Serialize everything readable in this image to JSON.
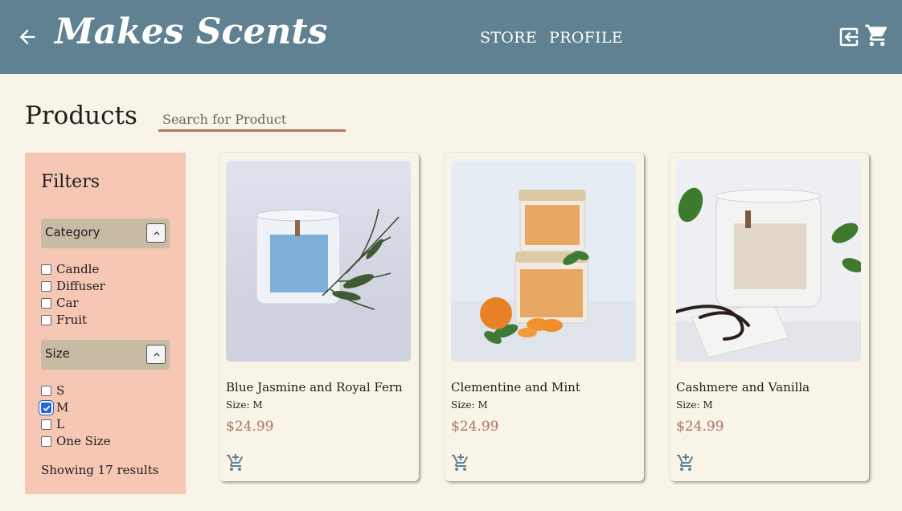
{
  "header": {
    "brand": "Makes Scents",
    "nav": [
      {
        "label": "STORE"
      },
      {
        "label": "PROFILE"
      }
    ],
    "icons": [
      "arrow-left-icon",
      "logout-icon",
      "shopping-cart-icon"
    ],
    "background_color": "#5f8191"
  },
  "main": {
    "title": "Products",
    "search": {
      "placeholder": "Search for Product",
      "value": ""
    }
  },
  "filters": {
    "title": "Filters",
    "category": {
      "label": "Category",
      "expanded": true,
      "options": [
        {
          "label": "Candle",
          "checked": false
        },
        {
          "label": "Diffuser",
          "checked": false
        },
        {
          "label": "Car",
          "checked": false
        },
        {
          "label": "Fruit",
          "checked": false
        }
      ]
    },
    "size": {
      "label": "Size",
      "expanded": true,
      "options": [
        {
          "label": "S",
          "checked": false
        },
        {
          "label": "M",
          "checked": true
        },
        {
          "label": "L",
          "checked": false
        },
        {
          "label": "One Size",
          "checked": false
        }
      ]
    },
    "results": "Showing 17 results",
    "panel_color": "#f5c7b4"
  },
  "products": [
    {
      "name": "Blue Jasmine and Royal Fern",
      "size": "Size: M",
      "price": "$24.99",
      "label_color": "#7fb0d9"
    },
    {
      "name": "Clementine and Mint",
      "size": "Size: M",
      "price": "$24.99",
      "label_color": "#e8a762"
    },
    {
      "name": "Cashmere and Vanilla",
      "size": "Size: M",
      "price": "$24.99",
      "label_color": "#e2d8c9"
    }
  ],
  "colors": {
    "background": "#f8f4e7",
    "price": "#b07460",
    "search_underline": "#b5765f"
  }
}
